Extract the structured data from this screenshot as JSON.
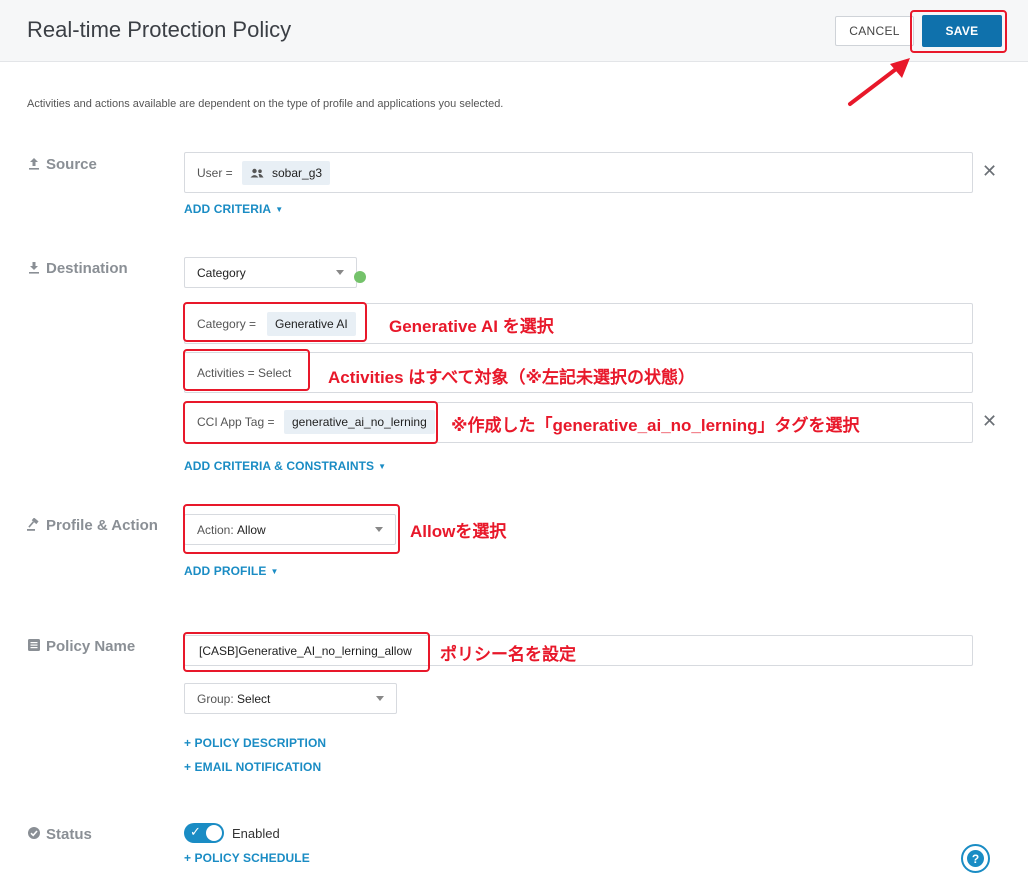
{
  "header": {
    "title": "Real-time Protection Policy",
    "cancel_label": "CANCEL",
    "save_label": "SAVE"
  },
  "intro_text": "Activities and actions available are dependent on the type of profile and applications you selected.",
  "source": {
    "label": "Source",
    "criteria_label": "User =",
    "user_chip": "sobar_g3",
    "add_criteria": "ADD CRITERIA"
  },
  "destination": {
    "label": "Destination",
    "select_value": "Category",
    "category_label": "Category =",
    "category_chip": "Generative AI",
    "activities_label": "Activities = Select",
    "cci_label": "CCI App Tag =",
    "cci_chip": "generative_ai_no_lerning",
    "add_criteria": "ADD CRITERIA & CONSTRAINTS"
  },
  "profile_action": {
    "label": "Profile & Action",
    "action_prefix": "Action:",
    "action_value": "Allow",
    "add_profile": "ADD PROFILE"
  },
  "policy_name": {
    "label": "Policy Name",
    "value": "[CASB]Generative_AI_no_lerning_allow",
    "group_prefix": "Group:",
    "group_value": "Select",
    "policy_description": "+ POLICY DESCRIPTION",
    "email_notification": "+ EMAIL NOTIFICATION"
  },
  "status": {
    "label": "Status",
    "toggle_label": "Enabled",
    "enabled": true,
    "policy_schedule": "+ POLICY SCHEDULE"
  },
  "annotations": {
    "category": "Generative AI を選択",
    "activities": "Activities はすべて対象（※左記未選択の状態）",
    "cci": "※作成した「generative_ai_no_lerning」タグを選択",
    "action": "Allowを選択",
    "policy_name": "ポリシー名を設定"
  },
  "colors": {
    "accent": "#1a8cc4",
    "save": "#0f71ac",
    "annotation": "#e8182a"
  },
  "icons": [
    "upload-icon",
    "download-icon",
    "gavel-icon",
    "list-icon",
    "check-circle-icon",
    "users-icon",
    "close-icon",
    "help-icon"
  ]
}
